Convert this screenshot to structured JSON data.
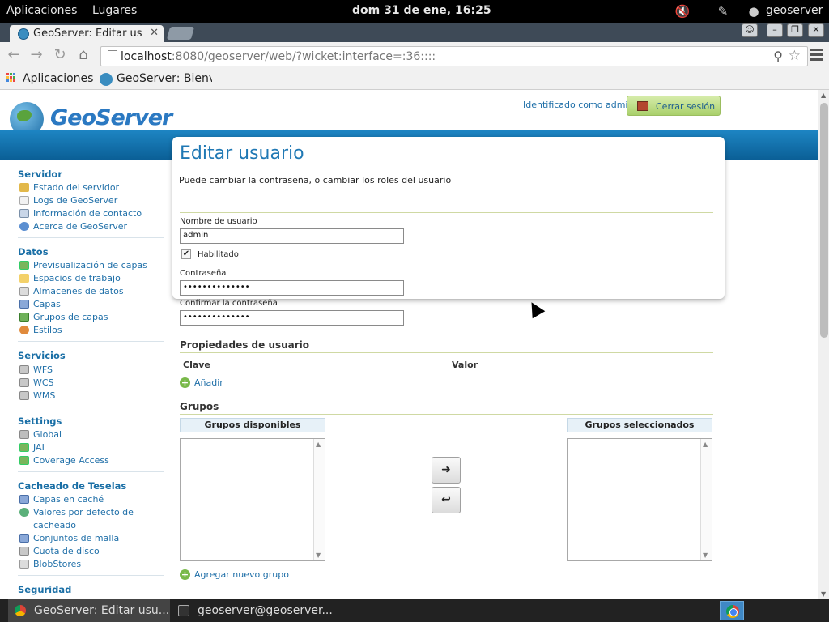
{
  "system_bar": {
    "applications": "Aplicaciones",
    "places": "Lugares",
    "clock": "dom 31 de ene, 16:25",
    "user": "geoserver"
  },
  "browser": {
    "tab_title": "GeoServer: Editar us",
    "url_host": "localhost",
    "url_rest": ":8080/geoserver/web/?wicket:interface=:36::::",
    "bookmarks": [
      "Aplicaciones",
      "GeoServer: Bienv"
    ]
  },
  "header": {
    "logo_text": "GeoServer",
    "logged_in": "Identificado como admin.",
    "logout": "Cerrar sesión"
  },
  "sidebar": {
    "sections": [
      {
        "title": "Servidor",
        "items": [
          "Estado del servidor",
          "Logs de GeoServer",
          "Información de contacto",
          "Acerca de GeoServer"
        ]
      },
      {
        "title": "Datos",
        "items": [
          "Previsualización de capas",
          "Espacios de trabajo",
          "Almacenes de datos",
          "Capas",
          "Grupos de capas",
          "Estilos"
        ]
      },
      {
        "title": "Servicios",
        "items": [
          "WFS",
          "WCS",
          "WMS"
        ]
      },
      {
        "title": "Settings",
        "items": [
          "Global",
          "JAI",
          "Coverage Access"
        ]
      },
      {
        "title": "Cacheado de Teselas",
        "items": [
          "Capas en caché",
          "Valores por defecto de cacheado",
          "Conjuntos de malla",
          "Cuota de disco",
          "BlobStores"
        ]
      },
      {
        "title": "Seguridad",
        "items": []
      }
    ]
  },
  "page": {
    "title": "Editar usuario",
    "description": "Puede cambiar la contraseña, o cambiar los roles del usuario",
    "username_label": "Nombre de usuario",
    "username_value": "admin",
    "enabled_label": "Habilitado",
    "password_label": "Contraseña",
    "password_value": "••••••••••••••",
    "confirm_label": "Confirmar la contraseña",
    "confirm_value": "••••••••••••••",
    "properties_title": "Propiedades de usuario",
    "col_key": "Clave",
    "col_value": "Valor",
    "add_label": "Añadir",
    "groups_title": "Grupos",
    "available_groups": "Grupos disponibles",
    "selected_groups": "Grupos seleccionados",
    "add_group_label": "Agregar nuevo grupo"
  },
  "taskbar": {
    "items": [
      "GeoServer: Editar usu...",
      "geoserver@geoserver..."
    ]
  }
}
